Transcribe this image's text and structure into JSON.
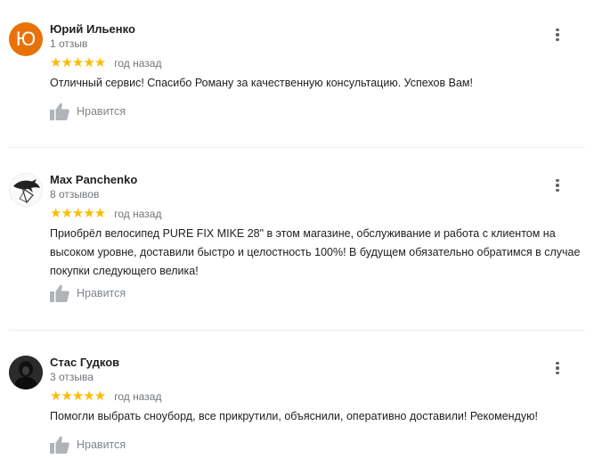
{
  "reviews": [
    {
      "name": "Юрий Ильенко",
      "count": "1 отзыв",
      "avatar_letter": "Ю",
      "stars": "★★★★★",
      "date": "год назад",
      "text": "Отличный сервис! Спасибо Роману за качественную консультацию. Успехов Вам!",
      "like_label": "Нравится"
    },
    {
      "name": "Max Panchenko",
      "count": "8 отзывов",
      "stars": "★★★★★",
      "date": "год назад",
      "text": "Приобрёл велосипед PURE FIX MIKE 28\" в этом магазине, обслуживание и работа с клиентом на высоком уровне, доставили быстро и целостность 100%! В будущем обязательно обратимся в случае покупки следующего велика!",
      "like_label": "Нравится"
    },
    {
      "name": "Стас Гудков",
      "count": "3 отзыва",
      "stars": "★★★★★",
      "date": "год назад",
      "text": "Помогли выбрать сноуборд, все прикрутили, объяснили, оперативно доставили! Рекомендую!",
      "like_label": "Нравится"
    }
  ],
  "colors": {
    "star": "#fbbc04",
    "avatar_orange": "#e8710a",
    "secondary_text": "#70757a"
  }
}
